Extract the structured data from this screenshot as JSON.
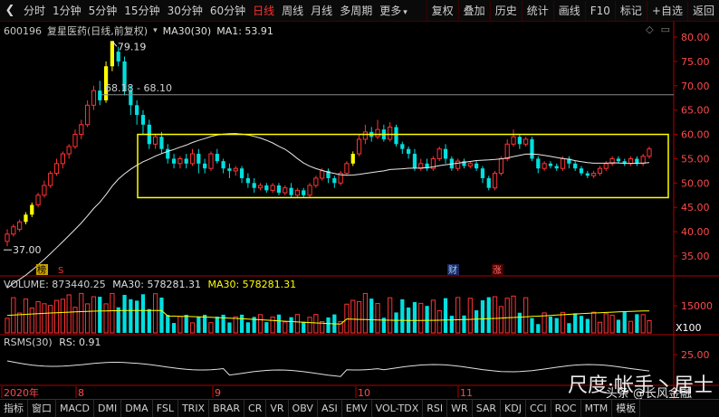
{
  "toolbar": {
    "back_icon": "chevron-left-icon",
    "periods": [
      "分时",
      "1分钟",
      "5分钟",
      "15分钟",
      "30分钟",
      "60分钟",
      "日线",
      "周线",
      "月线",
      "多周期",
      "更多"
    ],
    "active_period": "日线",
    "more_caret": "▾",
    "actions": [
      "复权",
      "叠加",
      "历史",
      "统计",
      "画线",
      "F10",
      "标记",
      "+自选",
      "返回"
    ]
  },
  "info": {
    "code": "600196",
    "name": "复星医药(日线,前复权)",
    "ma30_label": "MA30(30)",
    "ma1_label": "MA1: 53.91"
  },
  "price_axis": {
    "ticks": [
      "80.00",
      "75.00",
      "70.00",
      "65.00",
      "60.00",
      "55.00",
      "50.00",
      "45.00",
      "40.00",
      "35.00"
    ],
    "high_label": "79.19",
    "low_label": "37.00",
    "ref_line_label": "68.18 - 68.10"
  },
  "markers": {
    "bang": "榜",
    "s": "S",
    "cai": "财",
    "zhang": "涨"
  },
  "volume": {
    "label": "VOLUME: 873440.25",
    "ma30_white": "MA30: 578281.31",
    "ma30_yellow": "MA30: 578281.31",
    "tick": "15000",
    "unit": "X100"
  },
  "rsms": {
    "label": "RSMS(30)",
    "rs": "RS: 0.91",
    "tick": "25.00"
  },
  "time_axis": {
    "labels": [
      "2020年",
      "8",
      "9",
      "10",
      "11"
    ]
  },
  "bottom_tabs": [
    "指标",
    "窗口",
    "MACD",
    "DMI",
    "DMA",
    "FSL",
    "TRIX",
    "BRAR",
    "CR",
    "VR",
    "OBV",
    "ASI",
    "EMV",
    "VOL-TDX",
    "RSI",
    "WR",
    "SAR",
    "KDJ",
    "CCI",
    "ROC",
    "MTM",
    "模板"
  ],
  "watermark": {
    "main": "尺度·帐手丶居士",
    "sub": "头条 @长风金融"
  },
  "colors": {
    "up": "#ff3333",
    "down": "#00e0e0",
    "yellow": "#ffff00",
    "ma": "#e8e8e8",
    "axis": "#b00000"
  },
  "chart_data": {
    "type": "candlestick",
    "title": "600196 复星医药(日线,前复权)",
    "ylim": [
      33,
      82
    ],
    "candles": [
      {
        "o": 38,
        "c": 39.5,
        "h": 40.5,
        "l": 37.0
      },
      {
        "o": 39.5,
        "c": 41,
        "h": 41.5,
        "l": 39
      },
      {
        "o": 40.5,
        "c": 42,
        "h": 42.5,
        "l": 40
      },
      {
        "o": 42,
        "c": 43.5,
        "h": 44,
        "l": 41.5
      },
      {
        "o": 43.5,
        "c": 45.5,
        "h": 46,
        "l": 43
      },
      {
        "o": 45.5,
        "c": 47.5,
        "h": 48,
        "l": 45
      },
      {
        "o": 47.5,
        "c": 49.5,
        "h": 50.5,
        "l": 47
      },
      {
        "o": 49.5,
        "c": 52,
        "h": 52.5,
        "l": 49
      },
      {
        "o": 52,
        "c": 54,
        "h": 55,
        "l": 51.5
      },
      {
        "o": 54,
        "c": 56,
        "h": 56.5,
        "l": 53
      },
      {
        "o": 56,
        "c": 57.5,
        "h": 58,
        "l": 55
      },
      {
        "o": 57.5,
        "c": 60,
        "h": 61,
        "l": 57
      },
      {
        "o": 60,
        "c": 62,
        "h": 63,
        "l": 59
      },
      {
        "o": 62,
        "c": 66,
        "h": 67,
        "l": 61.5
      },
      {
        "o": 66,
        "c": 69,
        "h": 70,
        "l": 65
      },
      {
        "o": 69,
        "c": 67,
        "h": 71,
        "l": 66
      },
      {
        "o": 67,
        "c": 74,
        "h": 75,
        "l": 66.5
      },
      {
        "o": 74,
        "c": 79.19,
        "h": 79.19,
        "l": 73
      },
      {
        "o": 77,
        "c": 75,
        "h": 78,
        "l": 74
      },
      {
        "o": 75,
        "c": 69,
        "h": 76,
        "l": 68
      },
      {
        "o": 69,
        "c": 66,
        "h": 70,
        "l": 64
      },
      {
        "o": 66,
        "c": 64,
        "h": 67,
        "l": 62
      },
      {
        "o": 64,
        "c": 62,
        "h": 65,
        "l": 60
      },
      {
        "o": 62,
        "c": 58,
        "h": 63,
        "l": 57
      },
      {
        "o": 58,
        "c": 59.5,
        "h": 60,
        "l": 57
      },
      {
        "o": 59.5,
        "c": 57,
        "h": 60.5,
        "l": 56
      },
      {
        "o": 57,
        "c": 55,
        "h": 58,
        "l": 54
      },
      {
        "o": 55,
        "c": 54,
        "h": 56,
        "l": 53
      },
      {
        "o": 54,
        "c": 55,
        "h": 55.5,
        "l": 53
      },
      {
        "o": 55,
        "c": 54,
        "h": 56,
        "l": 53
      },
      {
        "o": 54,
        "c": 56,
        "h": 57,
        "l": 53.5
      },
      {
        "o": 56,
        "c": 54,
        "h": 57,
        "l": 52
      },
      {
        "o": 54,
        "c": 53,
        "h": 55,
        "l": 52
      },
      {
        "o": 53,
        "c": 56,
        "h": 56.5,
        "l": 52.5
      },
      {
        "o": 56,
        "c": 54.5,
        "h": 57,
        "l": 54
      },
      {
        "o": 54.5,
        "c": 53,
        "h": 55,
        "l": 52
      },
      {
        "o": 53,
        "c": 52.5,
        "h": 54,
        "l": 51
      },
      {
        "o": 52.5,
        "c": 53,
        "h": 53.5,
        "l": 51.5
      },
      {
        "o": 53,
        "c": 51,
        "h": 53.5,
        "l": 50
      },
      {
        "o": 51,
        "c": 50,
        "h": 52,
        "l": 49
      },
      {
        "o": 50,
        "c": 49,
        "h": 51,
        "l": 48
      },
      {
        "o": 49,
        "c": 49.5,
        "h": 50,
        "l": 48.5
      },
      {
        "o": 49.5,
        "c": 48.5,
        "h": 50,
        "l": 48
      },
      {
        "o": 48.5,
        "c": 49.5,
        "h": 50,
        "l": 48
      },
      {
        "o": 49.5,
        "c": 48,
        "h": 50,
        "l": 47.5
      },
      {
        "o": 48,
        "c": 49,
        "h": 49.5,
        "l": 47.5
      },
      {
        "o": 49,
        "c": 47.5,
        "h": 50,
        "l": 47
      },
      {
        "o": 47.5,
        "c": 48.5,
        "h": 49,
        "l": 47
      },
      {
        "o": 48.5,
        "c": 47.5,
        "h": 49,
        "l": 47
      },
      {
        "o": 47.5,
        "c": 49.5,
        "h": 50,
        "l": 47
      },
      {
        "o": 49.5,
        "c": 51,
        "h": 51.5,
        "l": 49
      },
      {
        "o": 51,
        "c": 52.5,
        "h": 53,
        "l": 50.5
      },
      {
        "o": 52.5,
        "c": 51,
        "h": 53,
        "l": 50
      },
      {
        "o": 51,
        "c": 50,
        "h": 51.5,
        "l": 49
      },
      {
        "o": 50,
        "c": 52,
        "h": 52.5,
        "l": 49.5
      },
      {
        "o": 52,
        "c": 54,
        "h": 54.5,
        "l": 51.5
      },
      {
        "o": 54,
        "c": 56,
        "h": 56.5,
        "l": 53.5
      },
      {
        "o": 56,
        "c": 59,
        "h": 60,
        "l": 55.5
      },
      {
        "o": 59,
        "c": 60.5,
        "h": 62,
        "l": 58
      },
      {
        "o": 60.5,
        "c": 59.5,
        "h": 61.5,
        "l": 58.5
      },
      {
        "o": 59.5,
        "c": 61,
        "h": 63,
        "l": 59
      },
      {
        "o": 61,
        "c": 59,
        "h": 62,
        "l": 58.5
      },
      {
        "o": 59,
        "c": 61.5,
        "h": 62.5,
        "l": 58.5
      },
      {
        "o": 61.5,
        "c": 58,
        "h": 62,
        "l": 57.5
      },
      {
        "o": 58,
        "c": 57,
        "h": 58.5,
        "l": 56
      },
      {
        "o": 57,
        "c": 56,
        "h": 57.5,
        "l": 55
      },
      {
        "o": 56,
        "c": 53,
        "h": 57,
        "l": 52.5
      },
      {
        "o": 53,
        "c": 54,
        "h": 55,
        "l": 52.5
      },
      {
        "o": 54,
        "c": 53,
        "h": 55,
        "l": 52.5
      },
      {
        "o": 53,
        "c": 55,
        "h": 55.5,
        "l": 52.5
      },
      {
        "o": 55,
        "c": 57,
        "h": 57.5,
        "l": 54.5
      },
      {
        "o": 57,
        "c": 55,
        "h": 58,
        "l": 54
      },
      {
        "o": 55,
        "c": 53,
        "h": 55.5,
        "l": 52.5
      },
      {
        "o": 53,
        "c": 54.5,
        "h": 55,
        "l": 52.5
      },
      {
        "o": 54.5,
        "c": 53.5,
        "h": 55,
        "l": 53
      },
      {
        "o": 53.5,
        "c": 54,
        "h": 54.5,
        "l": 53
      },
      {
        "o": 54,
        "c": 53,
        "h": 54.5,
        "l": 52.5
      },
      {
        "o": 53,
        "c": 51,
        "h": 53.5,
        "l": 50
      },
      {
        "o": 51,
        "c": 49,
        "h": 51.5,
        "l": 48.5
      },
      {
        "o": 49,
        "c": 52,
        "h": 52.5,
        "l": 48.5
      },
      {
        "o": 52,
        "c": 55,
        "h": 55.5,
        "l": 51.5
      },
      {
        "o": 55,
        "c": 58,
        "h": 59,
        "l": 54.5
      },
      {
        "o": 58,
        "c": 59.5,
        "h": 61,
        "l": 57.5
      },
      {
        "o": 59.5,
        "c": 58,
        "h": 60,
        "l": 57
      },
      {
        "o": 58,
        "c": 59,
        "h": 59.5,
        "l": 57.5
      },
      {
        "o": 59,
        "c": 55,
        "h": 59.5,
        "l": 54.5
      },
      {
        "o": 55,
        "c": 53,
        "h": 55.5,
        "l": 52
      },
      {
        "o": 53,
        "c": 54,
        "h": 54.5,
        "l": 52.5
      },
      {
        "o": 54,
        "c": 53.5,
        "h": 54.5,
        "l": 53
      },
      {
        "o": 53.5,
        "c": 53,
        "h": 54,
        "l": 52.5
      },
      {
        "o": 53,
        "c": 55,
        "h": 55.5,
        "l": 52.5
      },
      {
        "o": 55,
        "c": 54,
        "h": 55.5,
        "l": 53
      },
      {
        "o": 54,
        "c": 53,
        "h": 54.5,
        "l": 52.5
      },
      {
        "o": 53,
        "c": 52,
        "h": 53.5,
        "l": 51.5
      },
      {
        "o": 52,
        "c": 51.5,
        "h": 52.5,
        "l": 51
      },
      {
        "o": 51.5,
        "c": 52,
        "h": 52.5,
        "l": 51
      },
      {
        "o": 52,
        "c": 53,
        "h": 53.5,
        "l": 51.5
      },
      {
        "o": 53,
        "c": 54,
        "h": 54.5,
        "l": 52.5
      },
      {
        "o": 54,
        "c": 55,
        "h": 55.5,
        "l": 53.5
      },
      {
        "o": 55,
        "c": 54.5,
        "h": 55.5,
        "l": 54
      },
      {
        "o": 54.5,
        "c": 54,
        "h": 55,
        "l": 53.5
      },
      {
        "o": 54,
        "c": 55,
        "h": 55.5,
        "l": 53.5
      },
      {
        "o": 55,
        "c": 54,
        "h": 55.5,
        "l": 53.5
      },
      {
        "o": 54,
        "c": 55.5,
        "h": 56,
        "l": 53.5
      },
      {
        "o": 55.5,
        "c": 57,
        "h": 57.5,
        "l": 55
      }
    ],
    "box": {
      "y_top": 60,
      "y_bottom": 47
    },
    "ref_line": 68.14
  }
}
